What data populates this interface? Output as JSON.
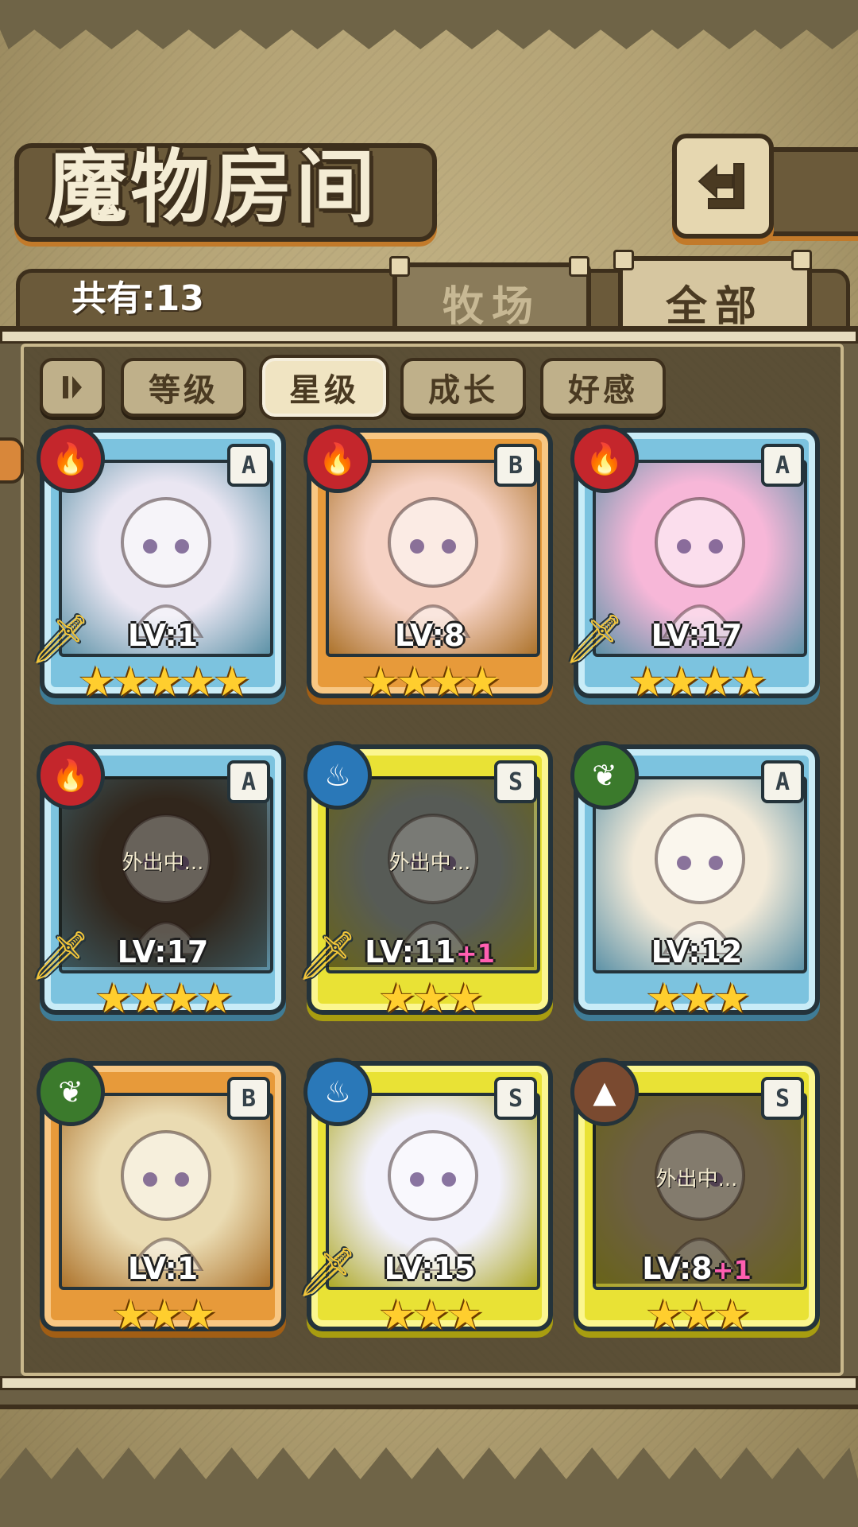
{
  "header": {
    "title": "魔物房间",
    "back_icon": "return-arrow-icon"
  },
  "count": {
    "label": "共有:13"
  },
  "tabs": [
    {
      "label": "牧场",
      "active": false
    },
    {
      "label": "全部",
      "active": true
    }
  ],
  "filters": {
    "toggle_icon": "pause-bars-icon",
    "buttons": [
      {
        "label": "等级",
        "active": false
      },
      {
        "label": "星级",
        "active": true
      },
      {
        "label": "成长",
        "active": false
      },
      {
        "label": "好感",
        "active": false
      }
    ]
  },
  "monsters": [
    {
      "element": "fire",
      "rank": "A",
      "level": "LV:1",
      "bonus": "",
      "stars": 5,
      "stars_text": "★★★★★",
      "weapon": true,
      "away": false,
      "away_text": "",
      "portrait": "#eae6f2"
    },
    {
      "element": "fire",
      "rank": "B",
      "level": "LV:8",
      "bonus": "",
      "stars": 4,
      "stars_text": "★★★★",
      "weapon": false,
      "away": false,
      "away_text": "",
      "portrait": "#f6d2c4"
    },
    {
      "element": "fire",
      "rank": "A",
      "level": "LV:17",
      "bonus": "",
      "stars": 4,
      "stars_text": "★★★★",
      "weapon": true,
      "away": false,
      "away_text": "",
      "portrait": "#f7b7d8"
    },
    {
      "element": "fire",
      "rank": "A",
      "level": "LV:17",
      "bonus": "",
      "stars": 4,
      "stars_text": "★★★★",
      "weapon": true,
      "away": true,
      "away_text": "外出中...",
      "portrait": "#4a3a30"
    },
    {
      "element": "water",
      "rank": "S",
      "level": "LV:11",
      "bonus": "+1",
      "stars": 3,
      "stars_text": "★★★",
      "weapon": true,
      "away": true,
      "away_text": "外出中...",
      "portrait": "#8e9a9a"
    },
    {
      "element": "nature",
      "rank": "A",
      "level": "LV:12",
      "bonus": "",
      "stars": 3,
      "stars_text": "★★★",
      "weapon": false,
      "away": false,
      "away_text": "",
      "portrait": "#f3ead8"
    },
    {
      "element": "nature",
      "rank": "B",
      "level": "LV:1",
      "bonus": "",
      "stars": 3,
      "stars_text": "★★★",
      "weapon": false,
      "away": false,
      "away_text": "",
      "portrait": "#eadbb2"
    },
    {
      "element": "water",
      "rank": "S",
      "level": "LV:15",
      "bonus": "",
      "stars": 3,
      "stars_text": "★★★",
      "weapon": true,
      "away": false,
      "away_text": "",
      "portrait": "#f1f0fa"
    },
    {
      "element": "earth",
      "rank": "S",
      "level": "LV:8",
      "bonus": "+1",
      "stars": 3,
      "stars_text": "★★★",
      "weapon": false,
      "away": true,
      "away_text": "外出中...",
      "portrait": "#b5a07a"
    }
  ],
  "element_icons": {
    "fire": "flame-icon",
    "water": "water-wave-icon",
    "nature": "leaf-icon",
    "earth": "mountain-icon"
  },
  "colors": {
    "rank_A": "#7cc3df",
    "rank_B": "#e79a3a",
    "rank_S": "#e9e235",
    "fire": "#c4262c",
    "water": "#2a78b8",
    "nature": "#3b7a2c",
    "earth": "#7a4a30",
    "bonus": "#ff5fb0",
    "star": "#ffce2e"
  }
}
